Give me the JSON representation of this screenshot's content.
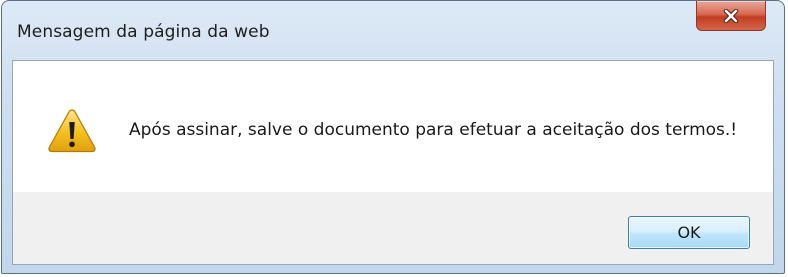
{
  "dialog": {
    "title": "Mensagem da página da web",
    "message": "Após assinar, salve o documento para efetuar a aceitação dos termos.!",
    "ok_label": "OK",
    "icon": "warning-icon",
    "close_icon": "close-icon"
  },
  "colors": {
    "close_button": "#c9452a",
    "warning_fill": "#f4c020",
    "ok_button_border": "#3c7fb1"
  }
}
